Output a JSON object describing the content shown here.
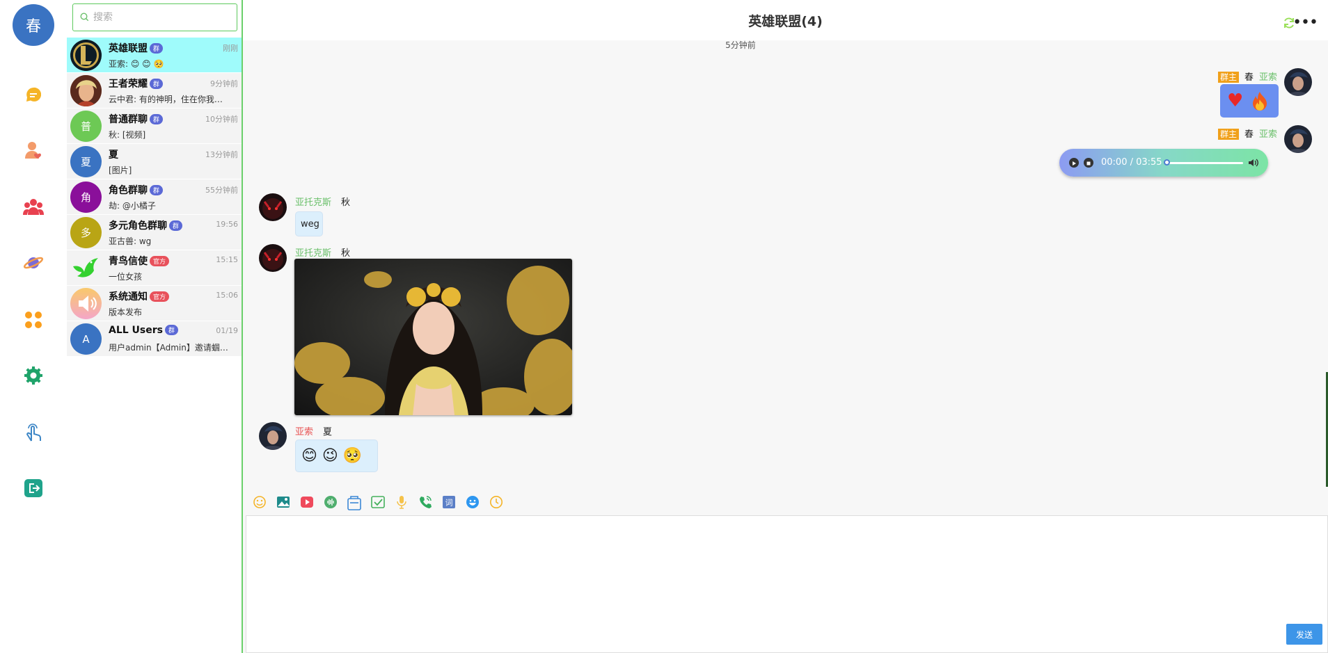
{
  "me": {
    "avatar_text": "春"
  },
  "nav": [
    {
      "name": "chat-nav-icon",
      "color": "#f5b427"
    },
    {
      "name": "friends-nav-icon",
      "color": "#f39b6a"
    },
    {
      "name": "groups-nav-icon",
      "color": "#e8414f"
    },
    {
      "name": "planet-nav-icon",
      "color": "#7b6bd6"
    },
    {
      "name": "apps-nav-icon",
      "color": "#fb9f1d"
    },
    {
      "name": "settings-nav-icon",
      "color": "#1fa36a"
    },
    {
      "name": "touch-nav-icon",
      "color": "#3d86c6"
    },
    {
      "name": "logout-nav-icon",
      "color": "#1fa38b"
    }
  ],
  "search": {
    "placeholder": "搜索"
  },
  "conversations": [
    {
      "name": "英雄联盟",
      "badge": "群",
      "badge_type": "qun",
      "time": "刚刚",
      "preview": "亚索: 😊 😊 🥺",
      "avatar_text": "",
      "avatar_color": "#1a2a3a",
      "active": true
    },
    {
      "name": "王者荣耀",
      "badge": "群",
      "badge_type": "qun",
      "time": "9分钟前",
      "preview": "云中君: 有的神明，住在你我…",
      "avatar_text": "",
      "avatar_color": "#b85a3a",
      "active": false
    },
    {
      "name": "普通群聊",
      "badge": "群",
      "badge_type": "qun",
      "time": "10分钟前",
      "preview": "秋: [视频]",
      "avatar_text": "普",
      "avatar_color": "#6dc955",
      "active": false
    },
    {
      "name": "夏",
      "badge": "",
      "badge_type": "",
      "time": "13分钟前",
      "preview": "[图片]",
      "avatar_text": "夏",
      "avatar_color": "#3a73c2",
      "active": false
    },
    {
      "name": "角色群聊",
      "badge": "群",
      "badge_type": "qun",
      "time": "55分钟前",
      "preview": "劫: @小橘子",
      "avatar_text": "角",
      "avatar_color": "#8a0f9a",
      "active": false
    },
    {
      "name": "多元角色群聊",
      "badge": "群",
      "badge_type": "qun",
      "time": "19:56",
      "preview": "亚古兽: wg",
      "avatar_text": "多",
      "avatar_color": "#b9a515",
      "active": false
    },
    {
      "name": "青鸟信使",
      "badge": "官方",
      "badge_type": "gf",
      "time": "15:15",
      "preview": "一位女孩",
      "avatar_text": "",
      "avatar_color": "#ffffff",
      "active": false
    },
    {
      "name": "系统通知",
      "badge": "官方",
      "badge_type": "gf",
      "time": "15:06",
      "preview": "版本发布",
      "avatar_text": "",
      "avatar_color": "#f6b5c8",
      "active": false
    },
    {
      "name": "ALL Users",
      "badge": "群",
      "badge_type": "qun",
      "time": "01/19",
      "preview": "用户admin【Admin】邀请蝈…",
      "avatar_text": "A",
      "avatar_color": "#3a73c2",
      "active": false
    }
  ],
  "header": {
    "title": "英雄联盟(4)"
  },
  "timestamp": "5分钟前",
  "messages": {
    "m1": {
      "role": "群主",
      "nick": "春",
      "uname": "亚索",
      "content": "❤️🔥"
    },
    "m2": {
      "role": "群主",
      "nick": "春",
      "uname": "亚索",
      "audio_time": "00:00 / 03:55",
      "progress": 0
    },
    "m3": {
      "uname": "亚托克斯",
      "nick": "秋",
      "text": "weg"
    },
    "m4": {
      "uname": "亚托克斯",
      "nick": "秋"
    },
    "m5": {
      "uname": "亚索",
      "nick": "夏",
      "emojis": "😊 😉 🥺"
    }
  },
  "toolbar": [
    "emoji-icon",
    "image-icon",
    "video-icon",
    "voice-icon",
    "file-icon",
    "task-icon",
    "mic-icon",
    "call-icon",
    "word-icon",
    "sticker-icon",
    "clock-icon"
  ],
  "send_label": "发送"
}
